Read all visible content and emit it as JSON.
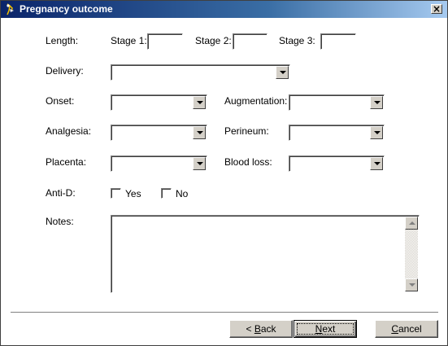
{
  "window": {
    "title": "Pregnancy outcome",
    "close_glyph": "×"
  },
  "form": {
    "length_label": "Length:",
    "stage1_label": "Stage 1:",
    "stage2_label": "Stage 2:",
    "stage3_label": "Stage 3:",
    "stage1_value": "",
    "stage2_value": "",
    "stage3_value": "",
    "delivery_label": "Delivery:",
    "delivery_value": "",
    "onset_label": "Onset:",
    "onset_value": "",
    "augmentation_label": "Augmentation:",
    "augmentation_value": "",
    "analgesia_label": "Analgesia:",
    "analgesia_value": "",
    "perineum_label": "Perineum:",
    "perineum_value": "",
    "placenta_label": "Placenta:",
    "placenta_value": "",
    "bloodloss_label": "Blood loss:",
    "bloodloss_value": "",
    "antid_label": "Anti-D:",
    "antid_yes_label": "Yes",
    "antid_no_label": "No",
    "antid_yes_checked": false,
    "antid_no_checked": false,
    "notes_label": "Notes:",
    "notes_value": ""
  },
  "buttons": {
    "back_prefix": "< ",
    "back_mnemonic": "B",
    "back_rest": "ack",
    "next_mnemonic": "N",
    "next_rest": "ext",
    "cancel_mnemonic": "C",
    "cancel_rest": "ancel"
  },
  "icons": {
    "app": "stork-app-icon",
    "dropdown": "chevron-down-icon",
    "scroll_up": "scroll-up-arrow-icon",
    "scroll_down": "scroll-down-arrow-icon"
  },
  "colors": {
    "titlebar_start": "#0a246a",
    "titlebar_end": "#a6caf0",
    "dialog_face": "#d4d0c8",
    "content_background": "#ffffff"
  }
}
